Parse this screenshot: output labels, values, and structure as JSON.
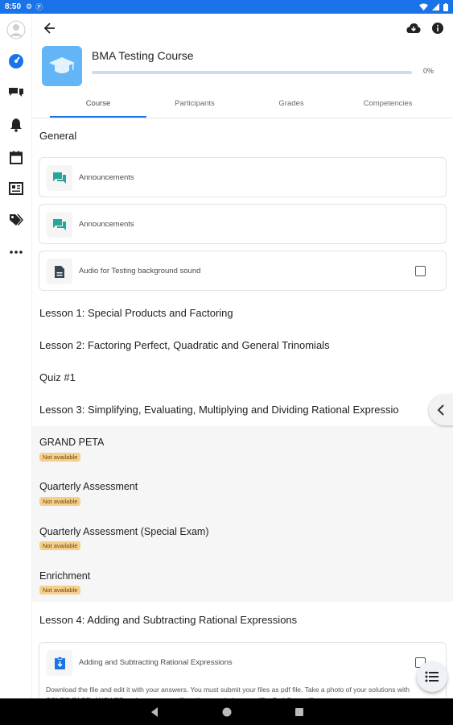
{
  "status_bar": {
    "time": "8:50",
    "notification_icons": [
      "gear-icon",
      "p-app-icon"
    ],
    "right_icons": [
      "wifi-icon",
      "signal-icon",
      "battery-icon"
    ]
  },
  "rail": {
    "items": [
      "avatar",
      "dashboard-icon",
      "messages-icon",
      "notifications-icon",
      "calendar-icon",
      "news-icon",
      "tags-icon",
      "more-icon"
    ]
  },
  "topbar": {
    "back_icon": "arrow-back-icon",
    "download_icon": "cloud-download-icon",
    "info_icon": "info-icon"
  },
  "course": {
    "title": "BMA Testing Course",
    "progress_text": "0%",
    "progress_value": 0
  },
  "tabs": [
    {
      "label": "Course",
      "active": true
    },
    {
      "label": "Participants",
      "active": false
    },
    {
      "label": "Grades",
      "active": false
    },
    {
      "label": "Competencies",
      "active": false
    }
  ],
  "general": {
    "title": "General",
    "activities": [
      {
        "label": "Announcements",
        "icon": "forum-icon",
        "has_checkbox": false
      },
      {
        "label": "Announcements",
        "icon": "forum-icon",
        "has_checkbox": false
      },
      {
        "label": "Audio for Testing background sound",
        "icon": "file-icon",
        "has_checkbox": true
      }
    ]
  },
  "sections": [
    "Lesson 1: Special Products and Factoring",
    "Lesson 2: Factoring Perfect, Quadratic and General Trinomials",
    "Quiz #1",
    "Lesson 3: Simplifying, Evaluating, Multiplying and Dividing Rational Expressio"
  ],
  "restricted_sections": [
    {
      "title": "GRAND PETA",
      "badge": "Not available"
    },
    {
      "title": "Quarterly Assessment",
      "badge": "Not available"
    },
    {
      "title": "Quarterly Assessment (Special Exam)",
      "badge": "Not available"
    },
    {
      "title": "Enrichment",
      "badge": "Not available"
    }
  ],
  "lesson4": {
    "title": "Lesson 4: Adding and Subtracting Rational Expressions",
    "activity": {
      "label": "Adding and Subtracting Rational Expressions",
      "icon": "assignment-icon",
      "description": "Download the file and edit it with your answers. You must submit your files as pdf file. Take a photo of your solutions with COVER PAGE. ANSWER and rename your file with your whole name (Ex. Sarl Cruz.pdf)"
    }
  },
  "colors": {
    "accent": "#1a73e8",
    "badge_bg": "#f6cf8e",
    "course_image": "#64b5f6",
    "forum_icon": "#26a69a"
  }
}
